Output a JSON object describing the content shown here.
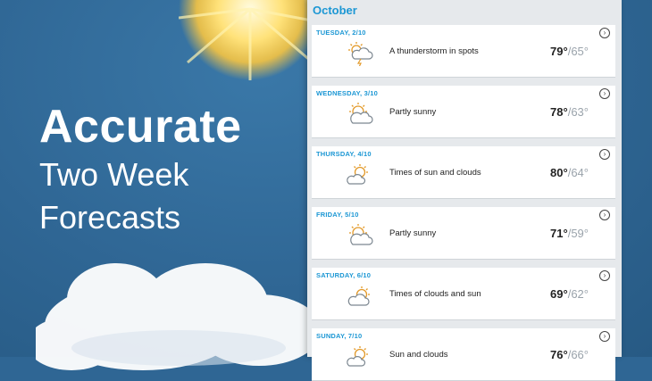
{
  "promo": {
    "headline": "Accurate",
    "line2": "Two Week",
    "line3": "Forecasts"
  },
  "forecast": {
    "month": "October",
    "days": [
      {
        "date": "TUESDAY, 2/10",
        "icon": "thunderstorm-icon",
        "desc": "A thunderstorm in spots",
        "high": "79°",
        "low": "/65°"
      },
      {
        "date": "WEDNESDAY, 3/10",
        "icon": "partly-sunny-icon",
        "desc": "Partly sunny",
        "high": "78°",
        "low": "/63°"
      },
      {
        "date": "THURSDAY, 4/10",
        "icon": "sun-and-clouds-icon",
        "desc": "Times of sun and clouds",
        "high": "80°",
        "low": "/64°"
      },
      {
        "date": "FRIDAY, 5/10",
        "icon": "partly-sunny-icon",
        "desc": "Partly sunny",
        "high": "71°",
        "low": "/59°"
      },
      {
        "date": "SATURDAY, 6/10",
        "icon": "clouds-and-sun-icon",
        "desc": "Times of clouds and sun",
        "high": "69°",
        "low": "/62°"
      },
      {
        "date": "SUNDAY, 7/10",
        "icon": "sun-and-clouds-icon",
        "desc": "Sun and clouds",
        "high": "76°",
        "low": "/66°"
      }
    ]
  },
  "colors": {
    "background": "#2f6694",
    "accent": "#1c97d4"
  }
}
